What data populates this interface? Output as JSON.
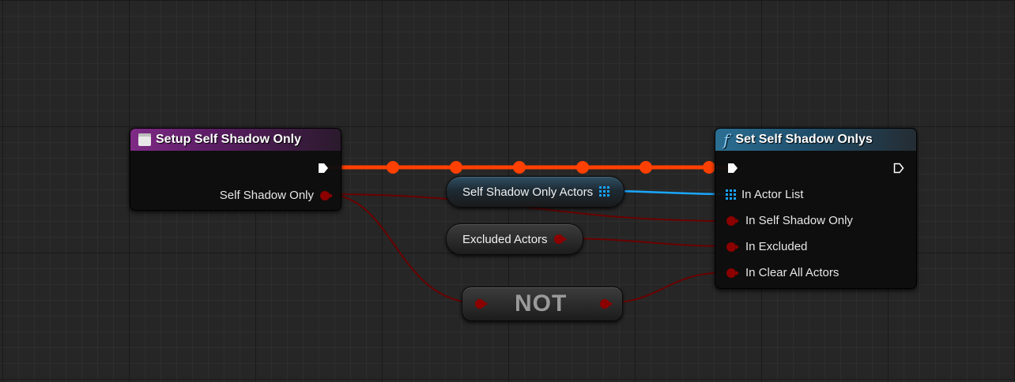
{
  "canvas": {
    "colors": {
      "background": "#262626",
      "exec_wire": "#ff4000",
      "bool_wire": "#6b0000",
      "array_wire": "#1aa7ff",
      "bool_pin": "#8c0000"
    }
  },
  "nodes": {
    "setup": {
      "title": "Setup Self Shadow Only",
      "icon": "event-icon",
      "outputs": {
        "self_shadow_only": "Self Shadow Only"
      }
    },
    "set_func": {
      "title": "Set Self Shadow Onlys",
      "icon": "function-icon",
      "icon_glyph": "f",
      "inputs": {
        "actor_list": "In Actor List",
        "self_shadow_only": "In Self Shadow Only",
        "excluded": "In Excluded",
        "clear_all": "In Clear All Actors"
      }
    },
    "var_actors": {
      "label": "Self Shadow Only Actors",
      "icon": "array-grid-icon"
    },
    "var_excluded": {
      "label": "Excluded Actors"
    },
    "not_node": {
      "label": "NOT"
    }
  }
}
